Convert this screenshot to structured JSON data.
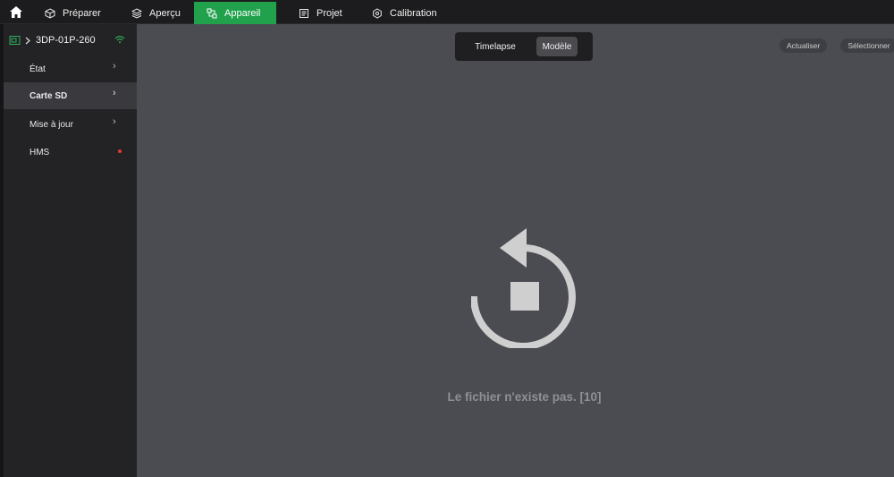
{
  "topbar": {
    "tabs": [
      {
        "label": "Préparer",
        "icon": "cube-icon"
      },
      {
        "label": "Aperçu",
        "icon": "layers-icon"
      },
      {
        "label": "Appareil",
        "icon": "device-icon",
        "active": true
      },
      {
        "label": "Projet",
        "icon": "document-icon"
      },
      {
        "label": "Calibration",
        "icon": "gear-icon"
      }
    ]
  },
  "sidebar": {
    "device_name": "3DP-01P-260",
    "items": [
      {
        "label": "État"
      },
      {
        "label": "Carte SD",
        "active": true
      },
      {
        "label": "Mise à jour"
      },
      {
        "label": "HMS",
        "alert": true
      }
    ]
  },
  "main": {
    "segment": {
      "timelapse": "Timelapse",
      "modele": "Modèle",
      "selected": "Modèle"
    },
    "refresh_label": "Actualiser",
    "select_label": "Sélectionner",
    "empty_message": "Le fichier n'existe pas. [10]"
  },
  "colors": {
    "accent": "#21a14c",
    "alert": "#e53935",
    "wifi": "#2fae5a",
    "main_bg": "#4b4c52",
    "sidebar_bg": "#232326"
  }
}
